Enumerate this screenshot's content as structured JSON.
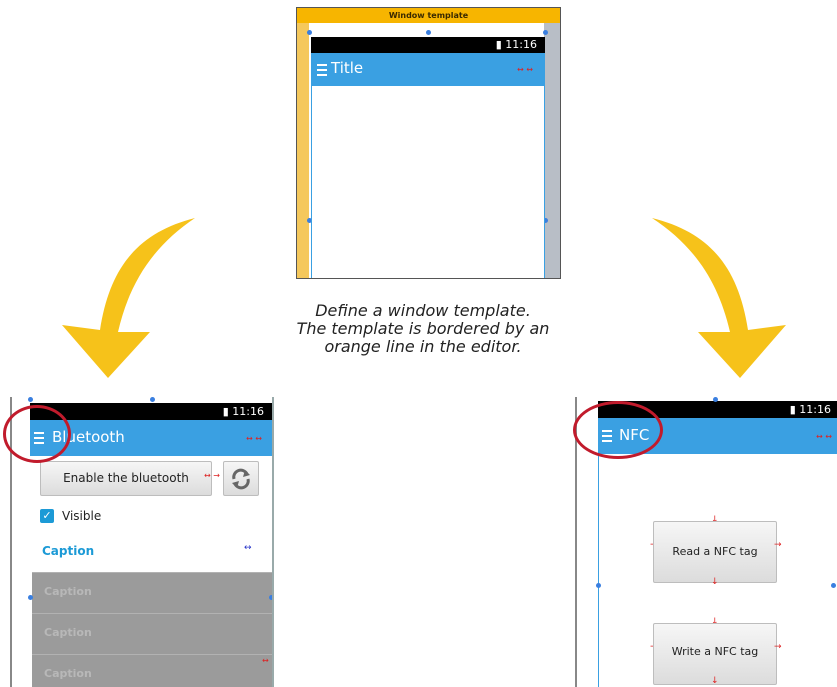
{
  "template_window": {
    "header": "Window template",
    "time": "11:16",
    "title": "Title"
  },
  "caption": {
    "line1": "Define a window template.",
    "line2": "The template is bordered by an",
    "line3": "orange line in the editor."
  },
  "bluetooth_window": {
    "time": "11:16",
    "title": "Bluetooth",
    "enable_button": "Enable the bluetooth",
    "visible_label": "Visible",
    "visible_checked": true,
    "caption_header": "Caption",
    "list_rows": [
      "Caption",
      "Caption",
      "Caption"
    ]
  },
  "nfc_window": {
    "time": "11:16",
    "title": "NFC",
    "read_button": "Read a NFC tag",
    "write_button": "Write a NFC tag"
  },
  "colors": {
    "accent": "#f7b500",
    "appbar": "#3aa0e2",
    "arrow": "#f6c21a",
    "ring": "#c11b2c",
    "caption_text": "#1c9ad6"
  }
}
